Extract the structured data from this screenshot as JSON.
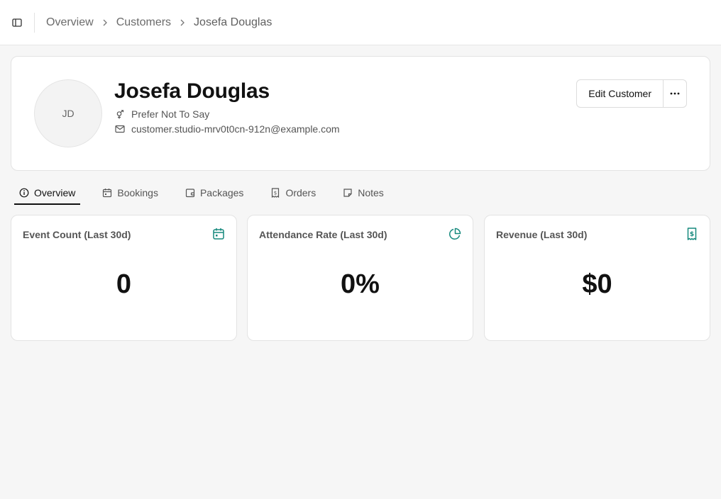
{
  "breadcrumb": {
    "items": [
      "Overview",
      "Customers",
      "Josefa Douglas"
    ]
  },
  "customer": {
    "initials": "JD",
    "name": "Josefa Douglas",
    "gender": "Prefer Not To Say",
    "email": "customer.studio-mrv0t0cn-912n@example.com"
  },
  "actions": {
    "edit_label": "Edit Customer",
    "more_icon": "ellipsis-icon"
  },
  "tabs": [
    {
      "label": "Overview",
      "icon": "info-icon",
      "active": true
    },
    {
      "label": "Bookings",
      "icon": "calendar-icon",
      "active": false
    },
    {
      "label": "Packages",
      "icon": "package-icon",
      "active": false
    },
    {
      "label": "Orders",
      "icon": "receipt-icon",
      "active": false
    },
    {
      "label": "Notes",
      "icon": "note-icon",
      "active": false
    }
  ],
  "stats": [
    {
      "title": "Event Count (Last 30d)",
      "value": "0",
      "icon": "calendar-icon"
    },
    {
      "title": "Attendance Rate (Last 30d)",
      "value": "0%",
      "icon": "pie-chart-icon"
    },
    {
      "title": "Revenue (Last 30d)",
      "value": "$0",
      "icon": "receipt-icon"
    }
  ],
  "colors": {
    "accent": "#16897d",
    "background": "#f6f6f6",
    "card": "#ffffff",
    "border": "#e3e3e3"
  }
}
